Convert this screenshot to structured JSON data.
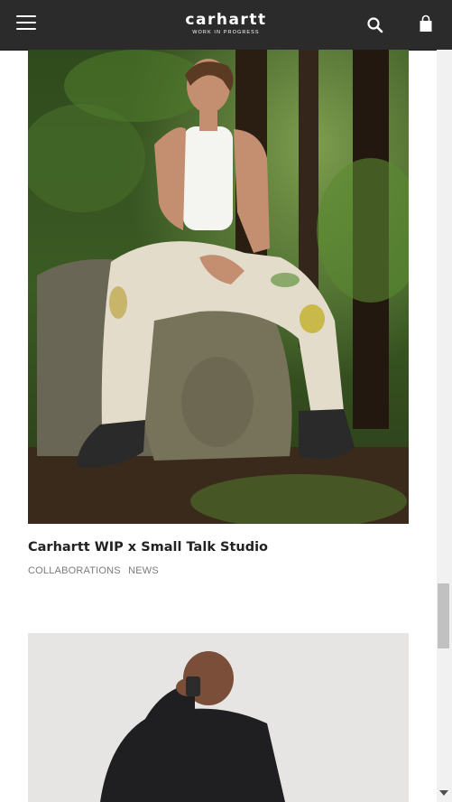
{
  "header": {
    "logo_text": "carhartt",
    "logo_subtext": "WORK IN PROGRESS",
    "menu_icon": "hamburger-menu-icon",
    "search_icon": "search-icon",
    "bag_icon": "shopping-bag-icon",
    "background": "#2b2b2b"
  },
  "articles": [
    {
      "title": "Carhartt WIP x Small Talk Studio",
      "tags": [
        "COLLABORATIONS",
        "NEWS"
      ]
    }
  ],
  "colors": {
    "title": "#222222",
    "tags": "#7a7a7a"
  }
}
